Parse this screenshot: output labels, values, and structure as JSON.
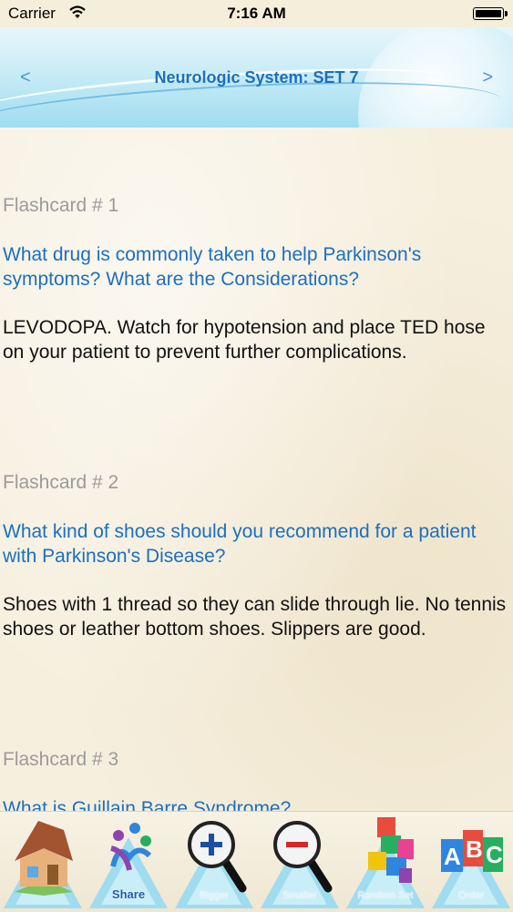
{
  "status_bar": {
    "carrier": "Carrier",
    "time": "7:16 AM"
  },
  "header": {
    "title": "Neurologic System: SET 7",
    "back_glyph": "<",
    "forward_glyph": ">"
  },
  "flashcards": [
    {
      "label": "Flashcard # 1",
      "question": "What drug is commonly taken to help Parkinson's symptoms? What are the Considerations?",
      "answer": "LEVODOPA. Watch for hypotension and place TED hose on your patient to prevent further complications."
    },
    {
      "label": "Flashcard # 2",
      "question": "What kind of shoes should you recommend for a patient with Parkinson's Disease?",
      "answer": "Shoes with 1 thread so they can slide through lie. No tennis shoes or leather bottom shoes. Slippers are good."
    },
    {
      "label": "Flashcard # 3",
      "question": "What is Guillain Barre Syndrome?",
      "answer": ""
    }
  ],
  "toolbar": {
    "items": [
      {
        "icon": "home-icon",
        "label": ""
      },
      {
        "icon": "share-icon",
        "label": "Share"
      },
      {
        "icon": "zoom-in-icon",
        "label": "Bigger"
      },
      {
        "icon": "zoom-out-icon",
        "label": "Smaller"
      },
      {
        "icon": "puzzle-icon",
        "label": "Random Set"
      },
      {
        "icon": "abc-icon",
        "label": "Order"
      }
    ]
  },
  "colors": {
    "accent": "#1b6fc0",
    "label_gray": "#9b9b9b",
    "header_sky": "#9fdcf0"
  }
}
